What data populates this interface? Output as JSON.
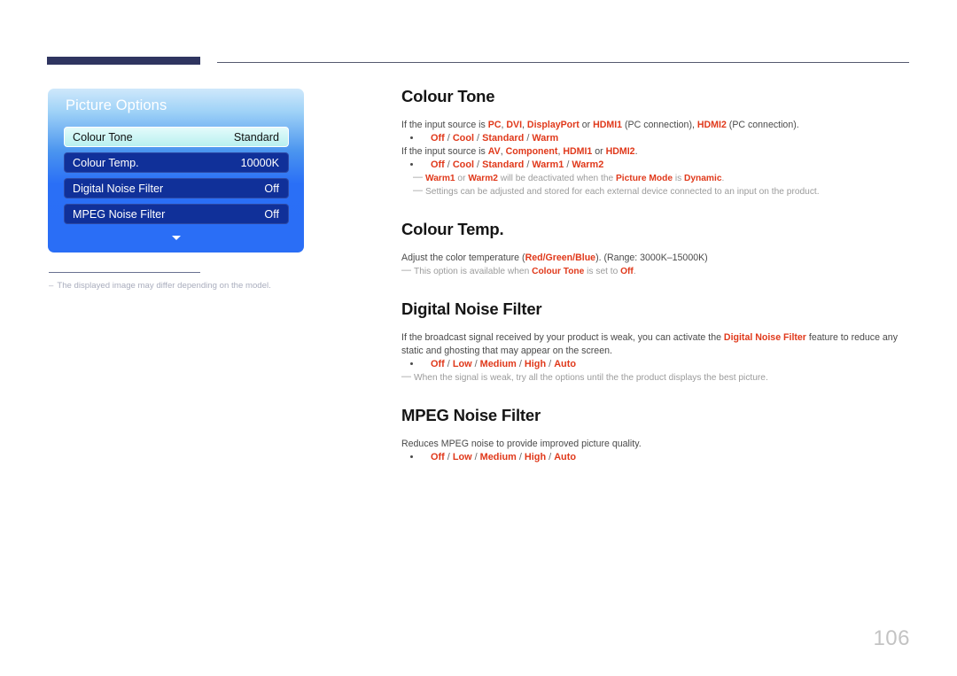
{
  "page": {
    "number": "106"
  },
  "osd": {
    "title": "Picture Options",
    "rows": [
      {
        "label": "Colour Tone",
        "value": "Standard",
        "selected": true
      },
      {
        "label": "Colour Temp.",
        "value": "10000K",
        "selected": false
      },
      {
        "label": "Digital Noise Filter",
        "value": "Off",
        "selected": false
      },
      {
        "label": "MPEG Noise Filter",
        "value": "Off",
        "selected": false
      }
    ],
    "scroll_arrow": "chevron-down",
    "footnote": {
      "dash": "–",
      "text": "The displayed image may differ depending on the model."
    }
  },
  "sections": {
    "colour_tone": {
      "title": "Colour Tone",
      "para1_a": "If the input source is ",
      "para1_pc": "PC",
      "para1_c1": ", ",
      "para1_dvi": "DVI",
      "para1_c2": ", ",
      "para1_dp": "DisplayPort",
      "para1_or": " or ",
      "para1_hdmi1": "HDMI1",
      "para1_pcconn1": " (PC connection), ",
      "para1_hdmi2": "HDMI2",
      "para1_pcconn2": " (PC connection).",
      "options1": [
        "Off",
        "Cool",
        "Standard",
        "Warm"
      ],
      "para2_a": "If the input source is ",
      "para2_av": "AV",
      "para2_c1": ", ",
      "para2_comp": "Component",
      "para2_c2": ", ",
      "para2_hdmi1": "HDMI1",
      "para2_or": " or ",
      "para2_hdmi2": "HDMI2",
      "para2_end": ".",
      "options2": [
        "Off",
        "Cool",
        "Standard",
        "Warm1",
        "Warm2"
      ],
      "note1_warm1": "Warm1",
      "note1_or": " or ",
      "note1_warm2": "Warm2",
      "note1_mid": " will be deactivated when the ",
      "note1_pm": "Picture Mode",
      "note1_is": " is ",
      "note1_dyn": "Dynamic",
      "note1_end": ".",
      "note2": "Settings can be adjusted and stored for each external device connected to an input on the product."
    },
    "colour_temp": {
      "title": "Colour Temp.",
      "para_a": "Adjust the color temperature (",
      "para_red": "Red",
      "para_s1": "/",
      "para_green": "Green",
      "para_s2": "/",
      "para_blue": "Blue",
      "para_b": "). (Range: 3000K–15000K)",
      "note_a": "This option is available when ",
      "note_ct": "Colour Tone",
      "note_b": " is set to ",
      "note_off": "Off",
      "note_c": "."
    },
    "digital_noise_filter": {
      "title": "Digital Noise Filter",
      "para_a": "If the broadcast signal received by your product is weak, you can activate the ",
      "para_dnf": "Digital Noise Filter",
      "para_b": " feature to reduce any static and ghosting that may appear on the screen.",
      "options": [
        "Off",
        "Low",
        "Medium",
        "High",
        "Auto"
      ],
      "note": "When the signal is weak, try all the options until the the product displays the best picture."
    },
    "mpeg_noise_filter": {
      "title": "MPEG Noise Filter",
      "para": "Reduces MPEG noise to provide improved picture quality.",
      "options": [
        "Off",
        "Low",
        "Medium",
        "High",
        "Auto"
      ]
    }
  },
  "colors": {
    "accent": "#e0391b",
    "header_bar": "#2f3560",
    "osd_row": "#103099",
    "osd_selected": "#c9f2f1",
    "page_number": "#c3c3c3"
  }
}
